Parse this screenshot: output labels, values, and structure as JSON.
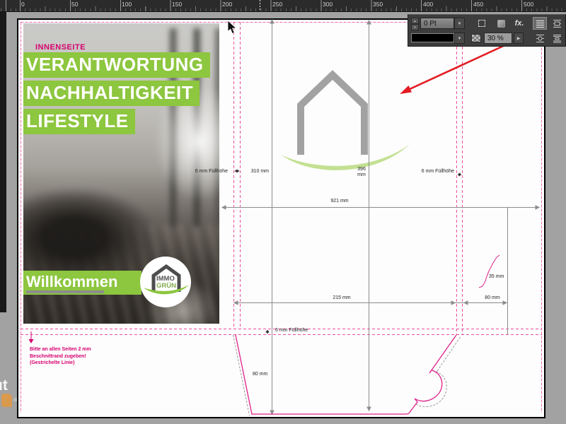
{
  "ruler": {
    "labels": [
      "0",
      "50",
      "100",
      "150",
      "200",
      "250",
      "300",
      "350",
      "400",
      "450",
      "500"
    ]
  },
  "panel": {
    "stroke_weight": "0 Pt",
    "fx_label": "fx.",
    "opacity": "30 %"
  },
  "brochure": {
    "kicker": "INNENSEITE",
    "headlines": [
      "VERANTWORTUNG",
      "NACHHALTIGKEIT",
      "LIFESTYLE"
    ],
    "welcome": "Willkommen",
    "logo": {
      "line1": "IMMO",
      "line2": "GRÜN"
    }
  },
  "dieline": {
    "fill_left": "6 mm Füllhöhe",
    "w_310": "310 mm",
    "w_396_value": "396",
    "w_396_unit": "mm",
    "fill_right": "6 mm Füllhöhe",
    "w_total": "921 mm",
    "w_215": "215 mm",
    "w_80": "80 mm",
    "w_35": "35 mm",
    "fill_bottom": "6 mm Füllhöhe",
    "h_80": "80 mm"
  },
  "note": {
    "line1": "Bitte an allen Seiten 2 mm",
    "line2": "Beschnittrand zugeben!",
    "line3": "(Gestrichelte Linie)"
  },
  "watermark": "ut",
  "colors": {
    "brand_green": "#8dc63f",
    "magenta": "#d6006e",
    "dieline_pink": "#e0218a",
    "arrow_red": "#e31b23"
  }
}
